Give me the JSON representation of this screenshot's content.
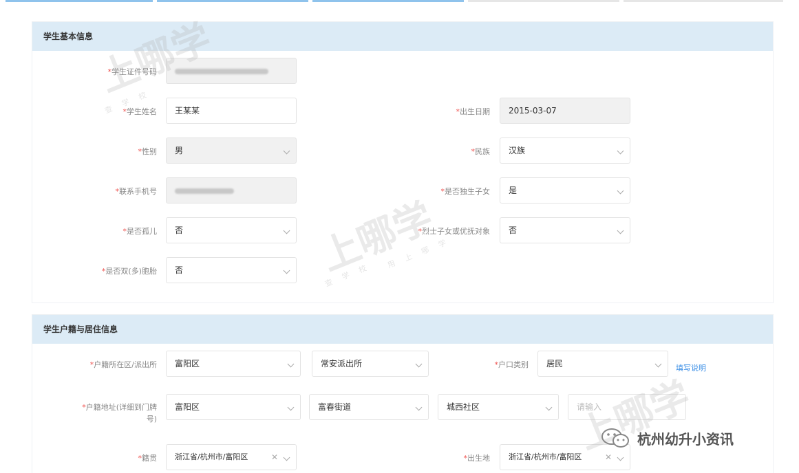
{
  "colors": {
    "accent": "#3a8ee6",
    "header_bg": "#dcebf6",
    "required": "#ef5350",
    "disabled_bg": "#f1f1f1"
  },
  "sections": {
    "basic": {
      "title": "学生基本信息"
    },
    "household": {
      "title": "学生户籍与居住信息"
    }
  },
  "form": {
    "id_number": {
      "label": "学生证件号码"
    },
    "name": {
      "label": "学生姓名",
      "value": "王某某"
    },
    "birth_date": {
      "label": "出生日期",
      "value": "2015-03-07"
    },
    "gender": {
      "label": "性别",
      "value": "男"
    },
    "ethnicity": {
      "label": "民族",
      "value": "汉族"
    },
    "phone": {
      "label": "联系手机号"
    },
    "only_child": {
      "label": "是否独生子女",
      "value": "是"
    },
    "orphan": {
      "label": "是否孤儿",
      "value": "否"
    },
    "martyr_child": {
      "label": "烈士子女或优抚对象",
      "value": "否"
    },
    "twins": {
      "label": "是否双(多)胞胎",
      "value": "否"
    },
    "hukou_district": {
      "label": "户籍所在区/派出所",
      "district": "富阳区",
      "station": "常安派出所"
    },
    "hukou_type": {
      "label": "户口类别",
      "value": "居民",
      "help_link": "填写说明"
    },
    "hukou_address": {
      "label_line1": "户籍地址(详细到门牌",
      "label_line2": "号)",
      "district": "富阳区",
      "street": "富春街道",
      "community": "城西社区",
      "detail_placeholder": "请输入"
    },
    "native_place": {
      "label": "籍贯",
      "value": "浙江省/杭州市/富阳区"
    },
    "birthplace": {
      "label": "出生地",
      "value": "浙江省/杭州市/富阳区"
    }
  },
  "watermark": {
    "text": "上哪学",
    "sub_a": "查 学 校",
    "sub_b": "用 上 哪 学"
  },
  "wechat_account": {
    "name": "杭州幼升小资讯"
  }
}
